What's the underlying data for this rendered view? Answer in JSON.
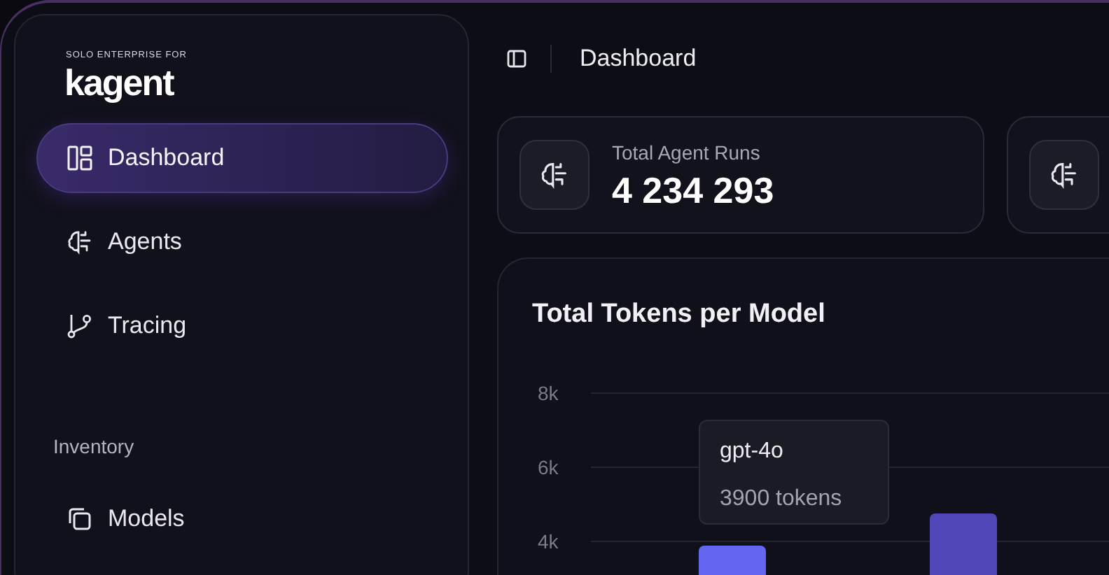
{
  "sidebar": {
    "brand_tagline": "SOLO ENTERPRISE FOR",
    "brand_name": "kagent",
    "items": [
      {
        "label": "Dashboard",
        "kind": "dashboard",
        "selected": true
      },
      {
        "label": "Agents",
        "kind": "agents",
        "selected": false
      },
      {
        "label": "Tracing",
        "kind": "tracing",
        "selected": false
      }
    ],
    "sections": [
      {
        "title": "Inventory",
        "items": [
          {
            "label": "Models",
            "kind": "models",
            "selected": false
          }
        ]
      }
    ]
  },
  "header": {
    "title": "Dashboard"
  },
  "stat_cards": [
    {
      "kind": "full",
      "label": "Total Agent Runs",
      "value": "4 234 293"
    },
    {
      "kind": "cut"
    }
  ],
  "chart_card": {
    "title": "Total Tokens per Model",
    "tooltip": {
      "title": "gpt-4o",
      "value": "3900 tokens"
    },
    "y_axis_labels": [
      "8k",
      "6k",
      "4k"
    ]
  }
}
